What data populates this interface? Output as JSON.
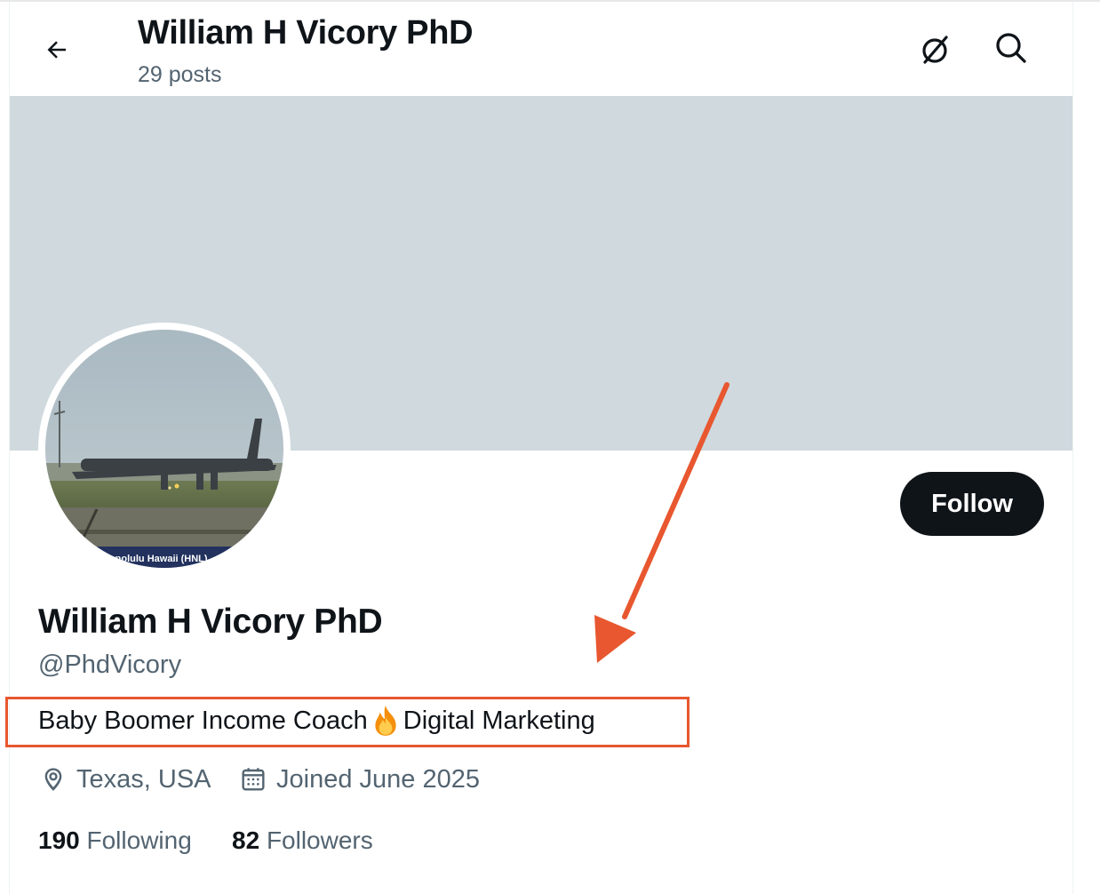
{
  "header": {
    "name": "William H Vicory PhD",
    "posts": "29 posts",
    "back_icon": "back-arrow-icon",
    "grok_icon": "grok-icon",
    "search_icon": "search-icon"
  },
  "profile": {
    "name": "William H Vicory PhD",
    "handle": "@PhdVicory",
    "bio_before": "Baby Boomer Income Coach",
    "bio_emoji": "fire-emoji-icon",
    "bio_after": "Digital Marketing",
    "location": "Texas, USA",
    "joined": "Joined June 2025",
    "following_count": "190",
    "following_label": "Following",
    "followers_count": "82",
    "followers_label": "Followers",
    "avatar_caption": "Honolulu Hawaii (HNL)"
  },
  "actions": {
    "follow_label": "Follow"
  },
  "annotation": {
    "color": "#e8572f"
  },
  "colors": {
    "banner": "#cfd9de",
    "text_primary": "#0f1419",
    "text_secondary": "#536471",
    "button_dark": "#0f1419"
  }
}
